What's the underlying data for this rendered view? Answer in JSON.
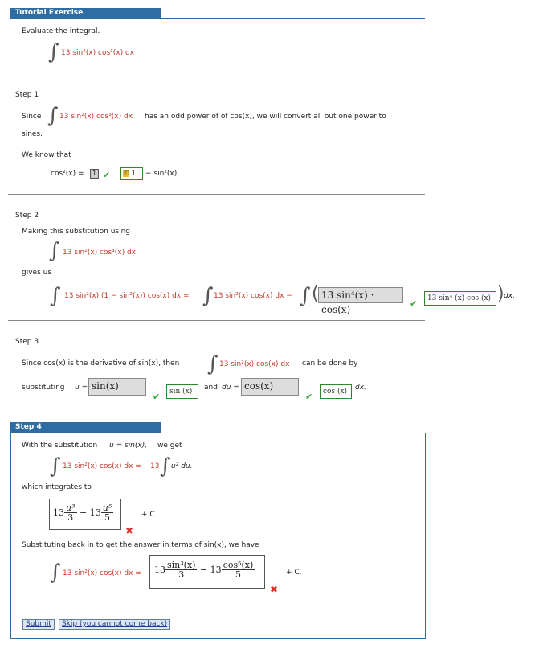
{
  "header_tab": "Tutorial Exercise",
  "intro": {
    "prompt": "Evaluate the integral.",
    "integrand": "13 sin²(x) cos³(x) dx"
  },
  "step1": {
    "label": "Step 1",
    "since": "Since",
    "integrand": "13 sin²(x) cos³(x) dx",
    "text_a": "has an odd power of of cos(x), we will convert all but one power to",
    "text_b": "sines.",
    "we_know": "We know that",
    "identity_lhs": "cos²(x) =",
    "box1_value": "1",
    "key1_value": "1",
    "identity_rhs": "− sin²(x)."
  },
  "step2": {
    "label": "Step 2",
    "making": "Making this substitution using",
    "integrand": "13 sin²(x) cos³(x) dx",
    "gives_us": "gives us",
    "expr_a": "13 sin²(x) (1 − sin²(x)) cos(x) dx =",
    "expr_b": "13 sin²(x) cos(x) dx −",
    "answer": "13 sin⁴(x) · cos(x)",
    "key": "13 sin⁴ (x) cos (x)",
    "tail": "dx."
  },
  "step3": {
    "label": "Step 3",
    "since": "Since  cos(x)  is the derivative of  sin(x),  then",
    "integrand": "13 sin²(x) cos(x) dx",
    "can_be": "can be done by",
    "substituting": "substituting",
    "u_eq": "u =",
    "u_answer": "sin(x)",
    "u_key": "sin (x)",
    "and_du": "and",
    "du_eq": "du =",
    "du_answer": "cos(x)",
    "du_key": "cos (x)",
    "tail": "dx."
  },
  "step4": {
    "label": "Step 4",
    "with_sub": "With the substitution",
    "u_def": "u = sin(x),",
    "we_get": "we get",
    "expr_lhs": "13 sin²(x) cos(x) dx =",
    "coef": "13",
    "expr_rhs": "u² du.",
    "which": "which integrates to",
    "ans1_c1": "13",
    "ans1_n1": "u³",
    "ans1_d1": "3",
    "ans1_minus": "− 13",
    "ans1_n2": "u⁵",
    "ans1_d2": "5",
    "plus_c": "+ C.",
    "sub_back": "Substituting back in to get the answer in terms of sin(x), we have",
    "final_lhs": "13 sin²(x) cos(x) dx =",
    "ans2_c1": "13",
    "ans2_n1": "sin³(x)",
    "ans2_d1": "3",
    "ans2_minus": "− 13",
    "ans2_n2": "cos⁵(x)",
    "ans2_d2": "5",
    "plus_c2": "+ C."
  },
  "buttons": {
    "submit": "Submit",
    "skip": "Skip (you cannot come back)"
  },
  "colors": {
    "accent": "#2e6ca4",
    "correct": "#3aa63a",
    "incorrect": "#d9342b",
    "math_red": "#c0392b"
  }
}
